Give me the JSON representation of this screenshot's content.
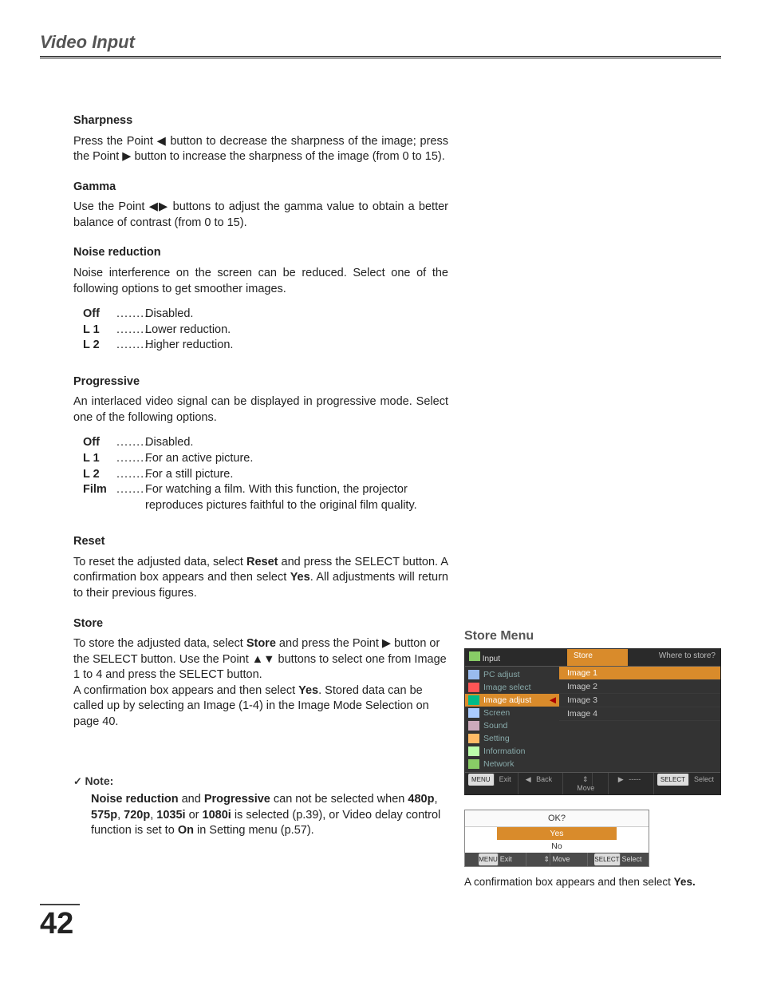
{
  "chapter_title": "Video Input",
  "page_number": "42",
  "sections": {
    "sharpness": {
      "title": "Sharpness",
      "body_pre": "Press the Point ",
      "body_mid1": " button to decrease the sharpness of the image; press the Point ",
      "body_post": " button to increase the sharpness of the image (from 0 to 15)."
    },
    "gamma": {
      "title": "Gamma",
      "body_pre": "Use the Point ",
      "body_post": " buttons to adjust the gamma value to obtain a better balance of contrast (from 0 to 15)."
    },
    "noise": {
      "title": "Noise reduction",
      "intro": "Noise interference on the screen can be reduced. Select one of the following options to get smoother images.",
      "opts": [
        {
          "k": "Off",
          "d": "Disabled."
        },
        {
          "k": "L 1",
          "d": "Lower reduction."
        },
        {
          "k": "L 2",
          "d": "Higher reduction."
        }
      ]
    },
    "progressive": {
      "title": "Progressive",
      "intro": "An interlaced video signal can be displayed in progressive mode. Select one of the following options.",
      "opts": [
        {
          "k": "Off",
          "d": "Disabled."
        },
        {
          "k": "L 1",
          "d": "For an active picture."
        },
        {
          "k": "L 2",
          "d": "For a still picture."
        },
        {
          "k": "Film",
          "d": "For watching a film. With this function, the projector reproduces pictures faithful to the original film quality."
        }
      ]
    },
    "reset": {
      "title": "Reset",
      "body_a": "To reset the adjusted data, select ",
      "body_b": " and press the SELECT button. A confirmation box appears and then select ",
      "body_c": ". All adjustments will return to their previous figures.",
      "bold1": "Reset",
      "bold2": "Yes"
    },
    "store": {
      "title": "Store",
      "body_a": "To store the adjusted data, select ",
      "bold1": "Store",
      "body_b": " and press the Point ▶ button or the SELECT button. Use the Point ▲▼ buttons to select one from Image 1 to 4 and press the SELECT button.",
      "body_c": "A confirmation box appears and then select ",
      "bold2": "Yes",
      "body_d": ". Stored data can be called up by selecting an Image (1-4) in the Image Mode Selection on page 40."
    },
    "note": {
      "label": "Note:",
      "b1": "Noise reduction",
      "t1": " and ",
      "b2": "Progressive",
      "t2": " can not be selected when ",
      "b3": "480p",
      "b4": "575p",
      "b5": "720p",
      "b6": "1035i",
      "b7": "1080i",
      "t3": " is selected (p.39), or Video delay control function is set to ",
      "b8": "On",
      "t4": " in Setting menu (p.57)."
    }
  },
  "figure": {
    "title": "Store Menu",
    "top_input_label": "Input",
    "top_store_label": "Store",
    "top_right": "Where to store?",
    "side_items": [
      "PC adjust",
      "Image select",
      "Image adjust",
      "Screen",
      "Sound",
      "Setting",
      "Information",
      "Network"
    ],
    "list_items": [
      "Image 1",
      "Image 2",
      "Image 3",
      "Image 4"
    ],
    "footer": {
      "exit": "Exit",
      "back": "Back",
      "move": "Move",
      "dash": "-----",
      "select": "Select"
    },
    "menu_key": "MENU",
    "select_key": "SELECT",
    "confirm": {
      "title": "OK?",
      "yes": "Yes",
      "no": "No"
    },
    "caption_a": "A confirmation box appears and then select ",
    "caption_b": "Yes."
  },
  "glyphs": {
    "left": "◀",
    "right": "▶",
    "up": "▲",
    "down": "▼",
    "updown": "▲▼",
    "leftright": "◀▶",
    "arrow_updown": "⇕"
  }
}
